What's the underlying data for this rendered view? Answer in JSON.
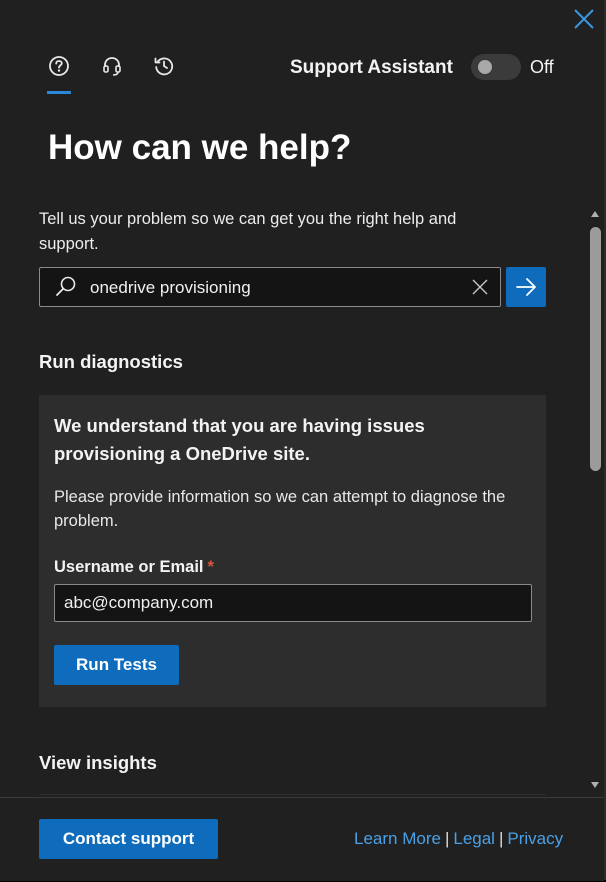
{
  "header": {
    "close_icon": "close-icon",
    "tabs": [
      {
        "icon": "help-circle-icon",
        "active": true
      },
      {
        "icon": "headset-icon",
        "active": false
      },
      {
        "icon": "history-icon",
        "active": false
      }
    ],
    "support_assistant_label": "Support Assistant",
    "toggle_state_label": "Off",
    "toggle_on": false
  },
  "title": "How can we help?",
  "intro_text": "Tell us your problem so we can get you the right help and support.",
  "search": {
    "value": "onedrive provisioning",
    "search_icon": "search-icon",
    "clear_icon": "clear-icon",
    "submit_icon": "arrow-right-icon"
  },
  "diagnostics": {
    "heading": "Run diagnostics",
    "card_title": "We understand that you are having issues provisioning a OneDrive site.",
    "card_description": "Please provide information so we can attempt to diagnose the problem.",
    "field_label": "Username or Email",
    "required_marker": "*",
    "email_value": "abc@company.com",
    "run_button_label": "Run Tests"
  },
  "insights": {
    "heading": "View insights"
  },
  "footer": {
    "contact_button_label": "Contact support",
    "links": [
      "Learn More",
      "Legal",
      "Privacy"
    ],
    "separator": "|"
  },
  "colors": {
    "background": "#202020",
    "card": "#2d2d2d",
    "accent": "#0f6cbd",
    "link": "#4aa0e6",
    "required": "#e0533a"
  }
}
